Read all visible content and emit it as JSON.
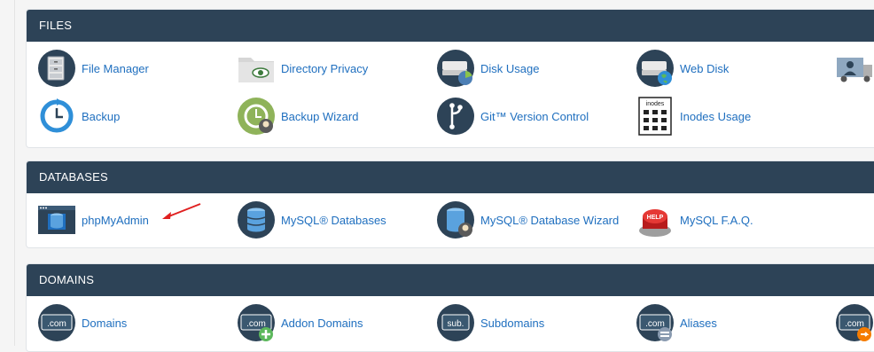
{
  "colors": {
    "header_bg": "#2d4357",
    "link": "#1f6fbf",
    "icon_bg": "#2d4357",
    "arrow": "#e02020"
  },
  "files": {
    "title": "FILES",
    "items": [
      {
        "label": "File Manager",
        "icon": "file-cabinet-icon"
      },
      {
        "label": "Directory Privacy",
        "icon": "folder-eye-icon"
      },
      {
        "label": "Disk Usage",
        "icon": "disk-pie-icon"
      },
      {
        "label": "Web Disk",
        "icon": "disk-globe-icon"
      },
      {
        "label": "",
        "icon": "ftp-truck-icon"
      },
      {
        "label": "Backup",
        "icon": "backup-clock-icon"
      },
      {
        "label": "Backup Wizard",
        "icon": "backup-wizard-icon"
      },
      {
        "label": "Git™ Version Control",
        "icon": "git-branch-icon"
      },
      {
        "label": "Inodes Usage",
        "icon": "inodes-calculator-icon"
      }
    ]
  },
  "databases": {
    "title": "DATABASES",
    "items": [
      {
        "label": "phpMyAdmin",
        "icon": "phpmyadmin-icon"
      },
      {
        "label": "MySQL® Databases",
        "icon": "database-icon"
      },
      {
        "label": "MySQL® Database Wizard",
        "icon": "database-wizard-icon"
      },
      {
        "label": "MySQL F.A.Q.",
        "icon": "help-button-icon"
      }
    ]
  },
  "domains": {
    "title": "DOMAINS",
    "items": [
      {
        "label": "Domains",
        "icon": "dotcom-icon",
        "badge": ".com"
      },
      {
        "label": "Addon Domains",
        "icon": "addon-domain-icon",
        "badge": ".com"
      },
      {
        "label": "Subdomains",
        "icon": "subdomain-icon",
        "badge": "sub."
      },
      {
        "label": "Aliases",
        "icon": "alias-domain-icon",
        "badge": ".com"
      },
      {
        "label": "",
        "icon": "redirect-domain-icon",
        "badge": ".com"
      }
    ]
  },
  "ftp_icon_text": "",
  "inodes_icon_text": "inodes",
  "help_icon_text": "HELP"
}
